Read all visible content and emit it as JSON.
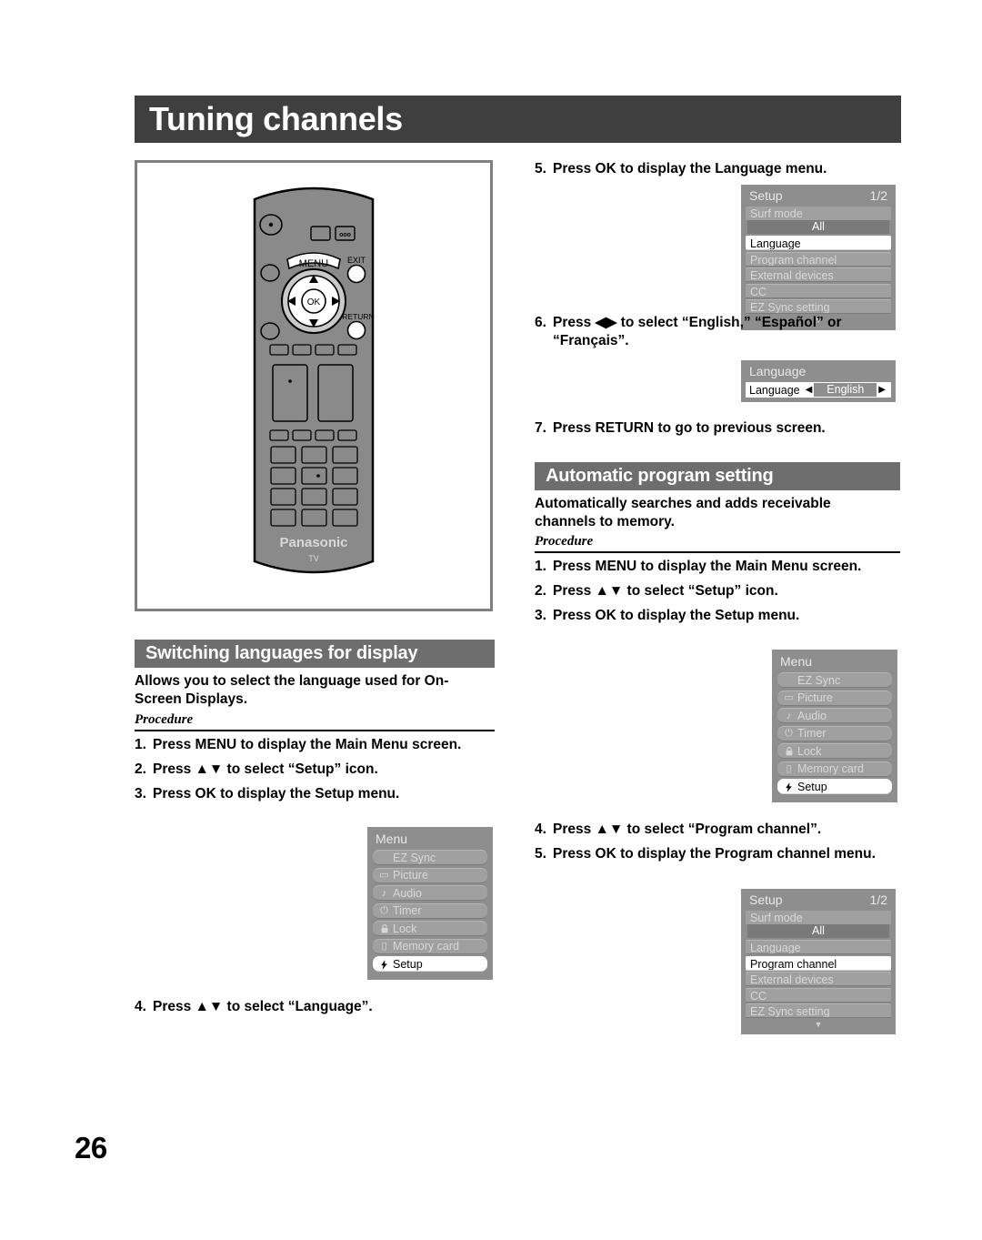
{
  "page": {
    "title": "Tuning channels",
    "number": "26"
  },
  "remote": {
    "brand": "Panasonic",
    "sub_brand": "TV",
    "menu_button": "MENU",
    "exit_button": "EXIT",
    "return_button": "RETURN",
    "ok_button": "OK",
    "up_arrow": "▲",
    "down_arrow": "▼",
    "left_arrow": "◀",
    "right_arrow": "▶"
  },
  "sections": {
    "switching_languages": {
      "heading": "Switching languages for display",
      "description": "Allows you to select the language used for On-Screen Displays.",
      "procedure_label": "Procedure",
      "steps": [
        {
          "num": "1.",
          "text": "Press MENU to display the Main Menu screen."
        },
        {
          "num": "2.",
          "text": "Press ▲▼ to select “Setup” icon."
        },
        {
          "num": "3.",
          "text": "Press OK to display the Setup menu."
        },
        {
          "num": "4.",
          "text": "Press ▲▼ to select “Language”."
        },
        {
          "num": "5.",
          "text": "Press OK to display the Language menu."
        },
        {
          "num": "6.",
          "text": "Press ◀▶ to select “English,” “Español” or “Français”."
        },
        {
          "num": "7.",
          "text": "Press RETURN to go to previous screen."
        }
      ]
    },
    "automatic_program_setting": {
      "heading": "Automatic program setting",
      "description": "Automatically searches and adds receivable channels to memory.",
      "procedure_label": "Procedure",
      "steps": [
        {
          "num": "1.",
          "text": "Press MENU to display the Main Menu screen."
        },
        {
          "num": "2.",
          "text": "Press ▲▼ to select “Setup” icon."
        },
        {
          "num": "3.",
          "text": "Press OK to display the Setup menu."
        },
        {
          "num": "4.",
          "text": "Press ▲▼ to select “Program channel”."
        },
        {
          "num": "5.",
          "text": "Press OK to display the Program channel menu."
        }
      ]
    }
  },
  "osd": {
    "main_menu": {
      "title": "Menu",
      "items": [
        {
          "label": "EZ Sync",
          "icon": "",
          "icon_name": "none",
          "selected": false
        },
        {
          "label": "Picture",
          "icon": "▭",
          "icon_name": "tv-screen-icon",
          "selected": false
        },
        {
          "label": "Audio",
          "icon": "♪",
          "icon_name": "music-note-icon",
          "selected": false
        },
        {
          "label": "Timer",
          "icon": "⏻",
          "icon_name": "power-clock-icon",
          "selected": false
        },
        {
          "label": "Lock",
          "icon": "ὑ2",
          "icon_name": "padlock-icon",
          "selected": false
        },
        {
          "label": "Memory card",
          "icon": "▯",
          "icon_name": "memory-card-icon",
          "selected": false
        },
        {
          "label": "Setup",
          "icon": "⚡",
          "icon_name": "setup-tool-icon",
          "selected": true
        }
      ]
    },
    "setup_menu_language_selected": {
      "title": "Setup",
      "page_indicator": "1/2",
      "surf_mode_label": "Surf mode",
      "surf_mode_value": "All",
      "items": [
        {
          "label": "Language",
          "selected": true
        },
        {
          "label": "Program channel",
          "selected": false
        },
        {
          "label": "External devices",
          "selected": false
        },
        {
          "label": "CC",
          "selected": false
        },
        {
          "label": "EZ Sync setting",
          "selected": false
        }
      ],
      "scroll_arrow": "▼"
    },
    "setup_menu_program_channel_selected": {
      "title": "Setup",
      "page_indicator": "1/2",
      "surf_mode_label": "Surf mode",
      "surf_mode_value": "All",
      "items": [
        {
          "label": "Language",
          "selected": false
        },
        {
          "label": "Program channel",
          "selected": true
        },
        {
          "label": "External devices",
          "selected": false
        },
        {
          "label": "CC",
          "selected": false
        },
        {
          "label": "EZ Sync setting",
          "selected": false
        }
      ],
      "scroll_arrow": "▼"
    },
    "language_menu": {
      "title": "Language",
      "row_label": "Language",
      "left_arrow": "◀",
      "value": "English",
      "right_arrow": "▶"
    }
  },
  "colors": {
    "title_bar": "#3f3f3f",
    "section_bar": "#6e6e6e",
    "osd_background": "#8e8e8e",
    "osd_row": "#a0a0a0",
    "osd_selected": "#ffffff",
    "remote_body": "#8a8a8a"
  }
}
